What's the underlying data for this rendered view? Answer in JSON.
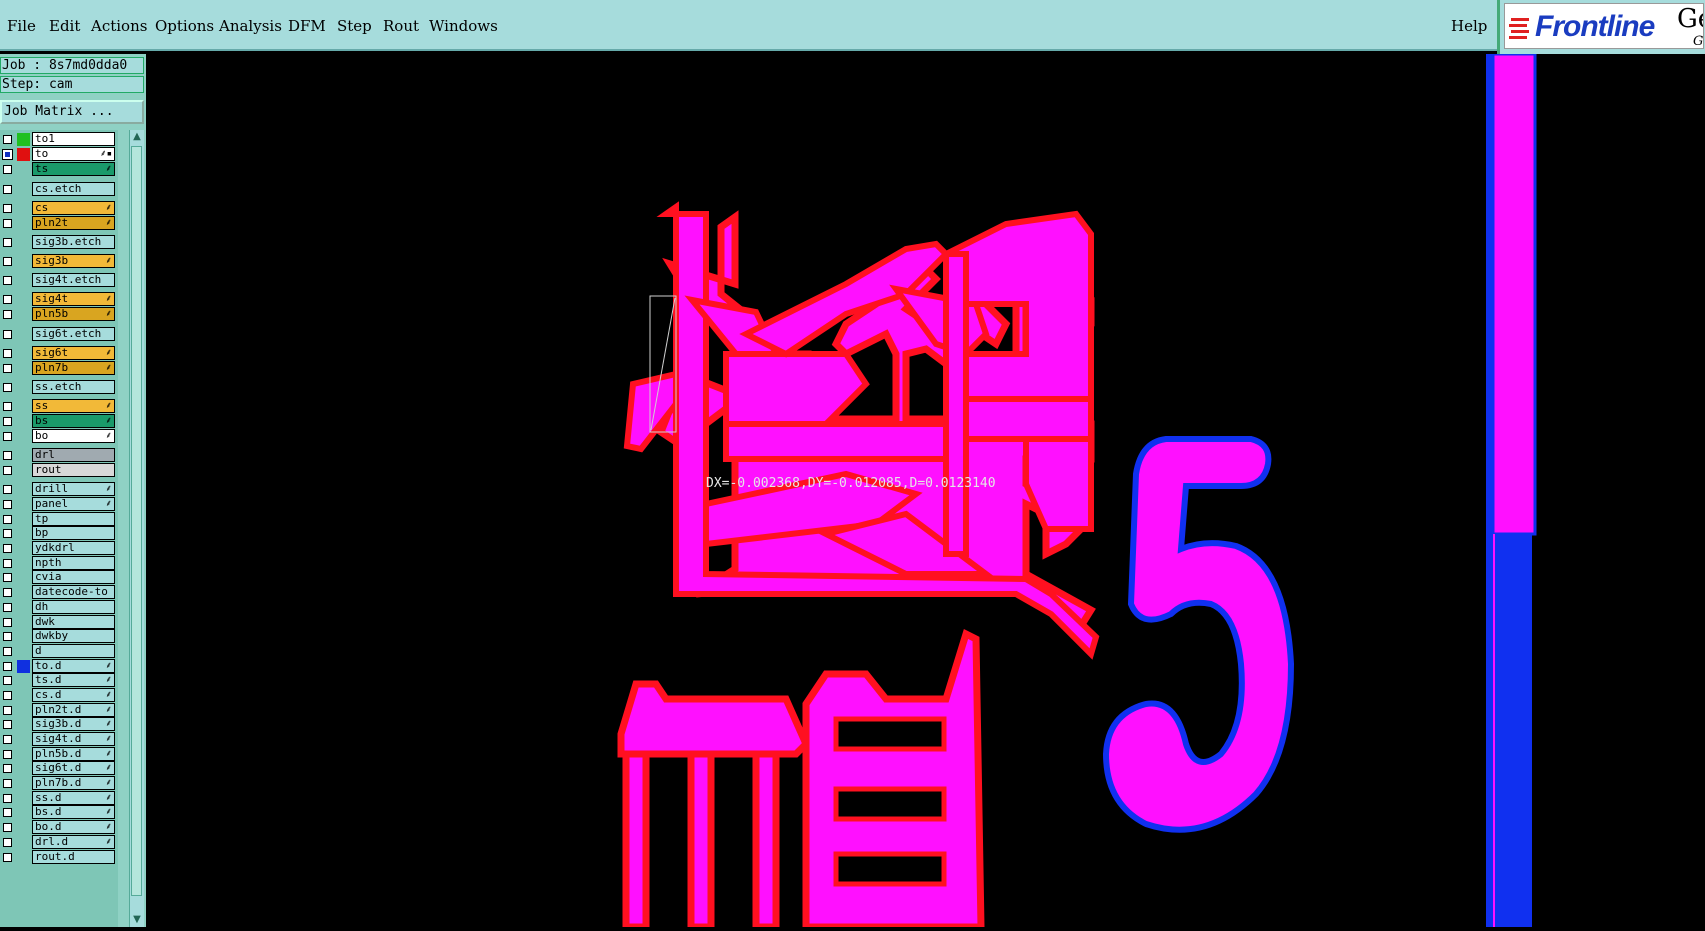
{
  "menu": {
    "file": "File",
    "edit": "Edit",
    "actions": "Actions",
    "options": "Options",
    "analysis": "Analysis",
    "dfm": "DFM",
    "step": "Step",
    "rout": "Rout",
    "windows": "Windows",
    "help": "Help"
  },
  "logo": {
    "brand": "Frontline",
    "product": "Gen",
    "sub": "Gr"
  },
  "job": {
    "job_line": "Job : 8s7md0dda0",
    "step_line": "Step: cam",
    "matrix_button": "Job Matrix ..."
  },
  "layers": [
    {
      "name": "to1",
      "swatch": "#20c020",
      "bg": "#ffffff",
      "mark": ""
    },
    {
      "name": "to",
      "swatch": "#e01010",
      "bg": "#ffffff",
      "mark": "⸙▪",
      "active": true
    },
    {
      "name": "ts",
      "swatch": "",
      "bg": "#1a9a6a",
      "mark": "⸙"
    },
    {
      "name": "cs.etch",
      "swatch": "",
      "bg": "#a6dcdc",
      "mark": ""
    },
    {
      "name": "cs",
      "swatch": "",
      "bg": "#f2b938",
      "mark": "⸙"
    },
    {
      "name": "pln2t",
      "swatch": "",
      "bg": "#d9a520",
      "mark": "⸙"
    },
    {
      "name": "sig3b.etch",
      "swatch": "",
      "bg": "#a6dcdc",
      "mark": ""
    },
    {
      "name": "sig3b",
      "swatch": "",
      "bg": "#f2b938",
      "mark": "⸙"
    },
    {
      "name": "sig4t.etch",
      "swatch": "",
      "bg": "#a6dcdc",
      "mark": ""
    },
    {
      "name": "sig4t",
      "swatch": "",
      "bg": "#f2b938",
      "mark": "⸙"
    },
    {
      "name": "pln5b",
      "swatch": "",
      "bg": "#d9a520",
      "mark": "⸙"
    },
    {
      "name": "sig6t.etch",
      "swatch": "",
      "bg": "#a6dcdc",
      "mark": ""
    },
    {
      "name": "sig6t",
      "swatch": "",
      "bg": "#f2b938",
      "mark": "⸙"
    },
    {
      "name": "pln7b",
      "swatch": "",
      "bg": "#d9a520",
      "mark": "⸙"
    },
    {
      "name": "ss.etch",
      "swatch": "",
      "bg": "#a6dcdc",
      "mark": ""
    },
    {
      "name": "ss",
      "swatch": "",
      "bg": "#f2b938",
      "mark": "⸙"
    },
    {
      "name": "bs",
      "swatch": "",
      "bg": "#1a9a6a",
      "mark": "⸙"
    },
    {
      "name": "bo",
      "swatch": "",
      "bg": "#ffffff",
      "mark": "⸙"
    },
    {
      "name": "drl",
      "swatch": "",
      "bg": "#a0aab0",
      "mark": ""
    },
    {
      "name": "rout",
      "swatch": "",
      "bg": "#d8d8d8",
      "mark": ""
    },
    {
      "name": "drill",
      "swatch": "",
      "bg": "#a6dcdc",
      "mark": "⸙"
    },
    {
      "name": "panel",
      "swatch": "",
      "bg": "#a6dcdc",
      "mark": "⸙"
    },
    {
      "name": "tp",
      "swatch": "",
      "bg": "#a6dcdc",
      "mark": ""
    },
    {
      "name": "bp",
      "swatch": "",
      "bg": "#a6dcdc",
      "mark": ""
    },
    {
      "name": "ydkdrl",
      "swatch": "",
      "bg": "#a6dcdc",
      "mark": ""
    },
    {
      "name": "npth",
      "swatch": "",
      "bg": "#a6dcdc",
      "mark": ""
    },
    {
      "name": "cvia",
      "swatch": "",
      "bg": "#a6dcdc",
      "mark": ""
    },
    {
      "name": "datecode-to",
      "swatch": "",
      "bg": "#a6dcdc",
      "mark": ""
    },
    {
      "name": "dh",
      "swatch": "",
      "bg": "#a6dcdc",
      "mark": ""
    },
    {
      "name": "dwk",
      "swatch": "",
      "bg": "#a6dcdc",
      "mark": ""
    },
    {
      "name": "dwkby",
      "swatch": "",
      "bg": "#a6dcdc",
      "mark": ""
    },
    {
      "name": "d",
      "swatch": "",
      "bg": "#a6dcdc",
      "mark": ""
    },
    {
      "name": "to.d",
      "swatch": "#1030e0",
      "bg": "#a6dcdc",
      "mark": "⸙"
    },
    {
      "name": "ts.d",
      "swatch": "",
      "bg": "#a6dcdc",
      "mark": "⸙"
    },
    {
      "name": "cs.d",
      "swatch": "",
      "bg": "#a6dcdc",
      "mark": "⸙"
    },
    {
      "name": "pln2t.d",
      "swatch": "",
      "bg": "#a6dcdc",
      "mark": "⸙"
    },
    {
      "name": "sig3b.d",
      "swatch": "",
      "bg": "#a6dcdc",
      "mark": "⸙"
    },
    {
      "name": "sig4t.d",
      "swatch": "",
      "bg": "#a6dcdc",
      "mark": "⸙"
    },
    {
      "name": "pln5b.d",
      "swatch": "",
      "bg": "#a6dcdc",
      "mark": "⸙"
    },
    {
      "name": "sig6t.d",
      "swatch": "",
      "bg": "#a6dcdc",
      "mark": "⸙"
    },
    {
      "name": "pln7b.d",
      "swatch": "",
      "bg": "#a6dcdc",
      "mark": "⸙"
    },
    {
      "name": "ss.d",
      "swatch": "",
      "bg": "#a6dcdc",
      "mark": "⸙"
    },
    {
      "name": "bs.d",
      "swatch": "",
      "bg": "#a6dcdc",
      "mark": "⸙"
    },
    {
      "name": "bo.d",
      "swatch": "",
      "bg": "#a6dcdc",
      "mark": "⸙"
    },
    {
      "name": "drl.d",
      "swatch": "",
      "bg": "#a6dcdc",
      "mark": "⸙"
    },
    {
      "name": "rout.d",
      "swatch": "",
      "bg": "#a6dcdc",
      "mark": ""
    }
  ],
  "canvas": {
    "measure_readout": "DX=-0.002368,DY=-0.012085,D=0.0123140",
    "digit": "5",
    "colors": {
      "fill": "#ff10ff",
      "red_outline": "#ff1020",
      "blue_outline": "#1030f0",
      "bg": "#000000"
    }
  }
}
